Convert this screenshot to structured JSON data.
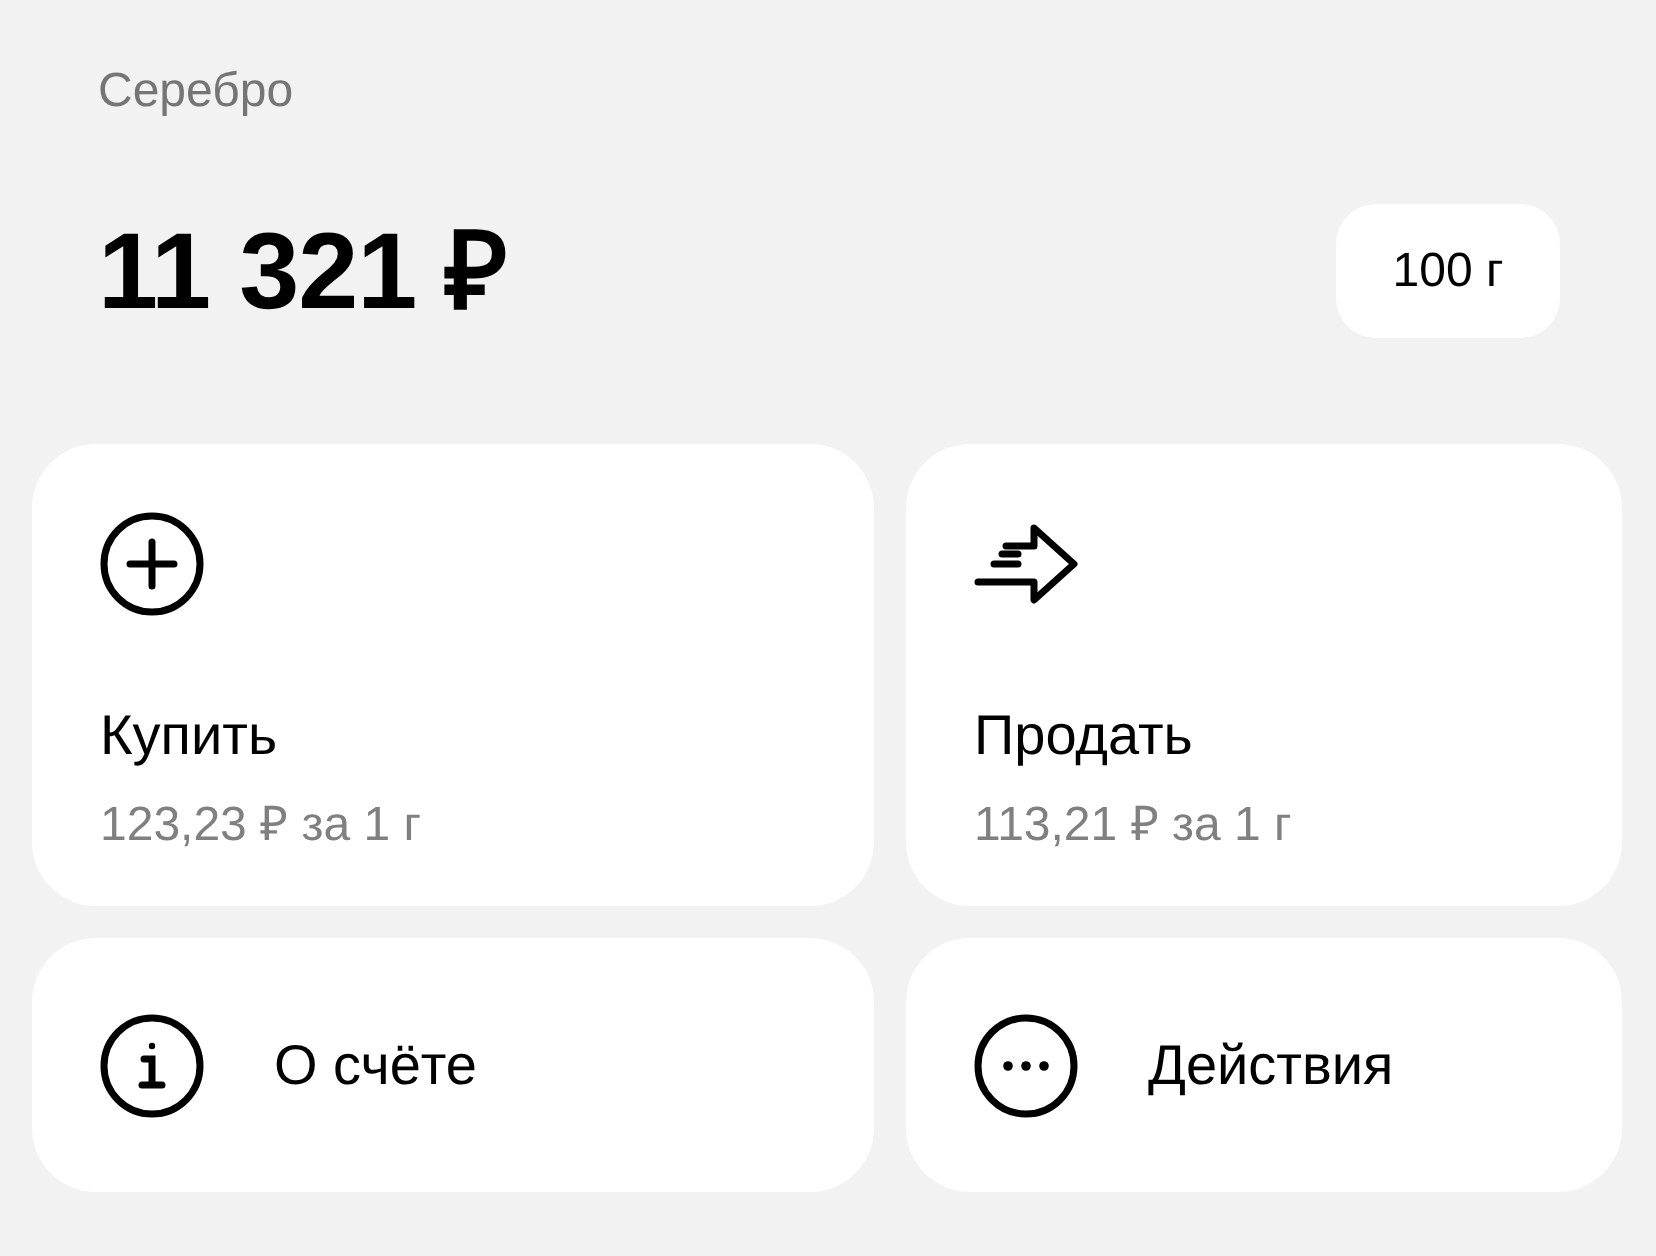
{
  "header": {
    "title": "Серебро",
    "amount": "11 321 ₽",
    "unit_chip": "100 г"
  },
  "actions": [
    {
      "kind": "tile",
      "label": "Купить",
      "price": "123,23 ₽ за 1 г"
    },
    {
      "kind": "tile",
      "label": "Продать",
      "price": "113,21 ₽ за 1 г"
    },
    {
      "kind": "row",
      "label": "О счёте"
    },
    {
      "kind": "row",
      "label": "Действия"
    }
  ]
}
